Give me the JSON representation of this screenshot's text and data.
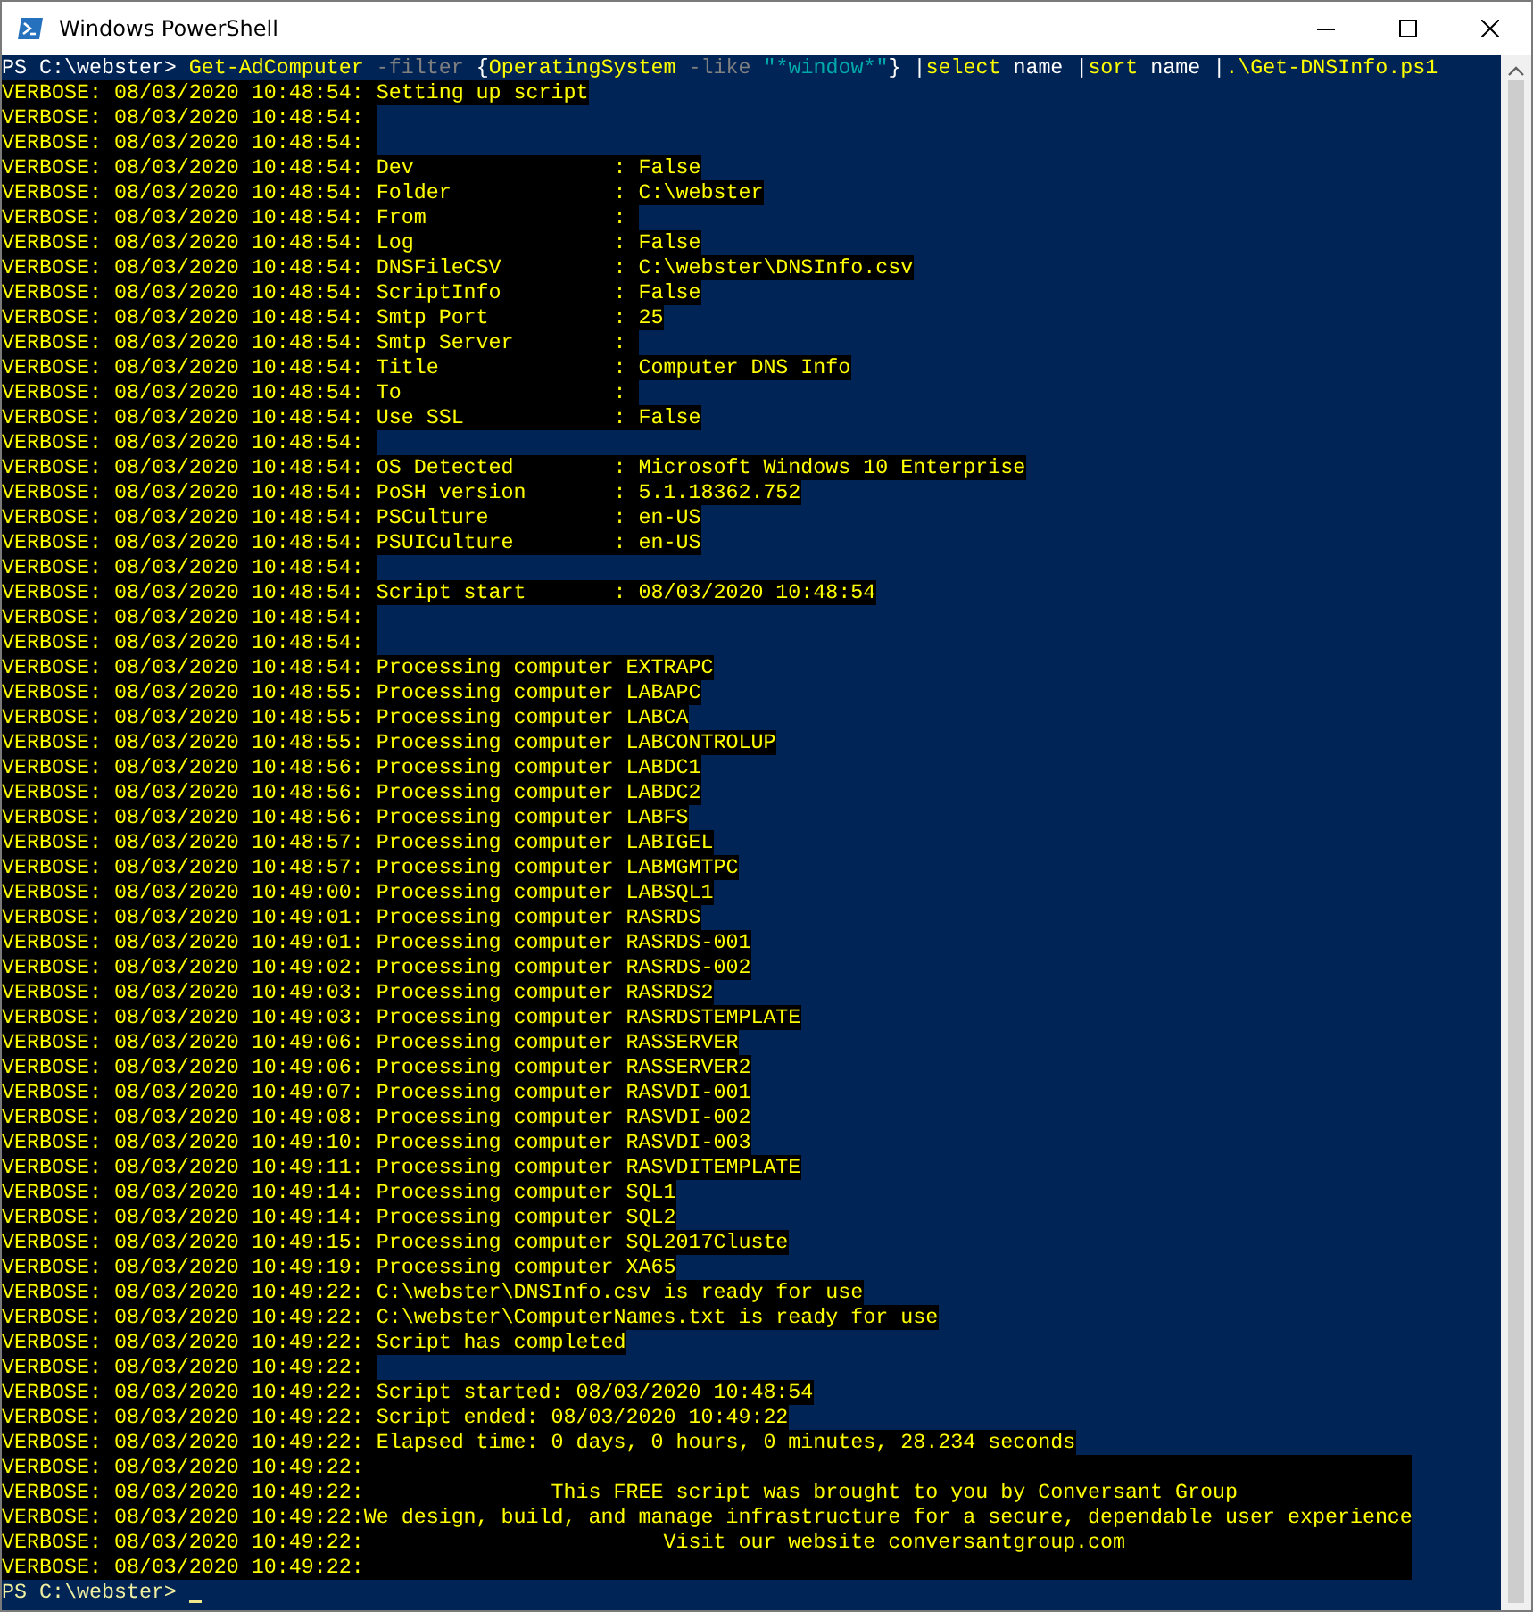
{
  "window": {
    "title": "Windows PowerShell"
  },
  "command": {
    "prompt": "PS C:\\webster>",
    "tokens": [
      {
        "text": "Get-AdComputer",
        "kind": "command"
      },
      {
        "text": "-filter",
        "kind": "parameter"
      },
      {
        "text": "{",
        "kind": "plain"
      },
      {
        "text": "OperatingSystem",
        "kind": "command",
        "join": true
      },
      {
        "text": "-like",
        "kind": "parameter"
      },
      {
        "text": "\"*window*\"",
        "kind": "string"
      },
      {
        "text": "}",
        "kind": "plain",
        "join": true
      },
      {
        "text": "|",
        "kind": "plain"
      },
      {
        "text": "select",
        "kind": "command",
        "join": true
      },
      {
        "text": "name",
        "kind": "plain"
      },
      {
        "text": "|",
        "kind": "plain"
      },
      {
        "text": "sort",
        "kind": "command",
        "join": true
      },
      {
        "text": "name",
        "kind": "plain"
      },
      {
        "text": "|",
        "kind": "plain"
      },
      {
        "text": ".\\Get-DNSInfo.ps1",
        "kind": "command",
        "join": true
      }
    ]
  },
  "lines": [
    {
      "kind": "message",
      "prefix": "VERBOSE: 08/03/2020 10:48:54:",
      "text": "Setting up script"
    },
    {
      "kind": "message",
      "prefix": "VERBOSE: 08/03/2020 10:48:54:"
    },
    {
      "kind": "message",
      "prefix": "VERBOSE: 08/03/2020 10:48:54:"
    },
    {
      "kind": "field",
      "prefix": "VERBOSE: 08/03/2020 10:48:54:",
      "key": "Dev",
      "sep": ":",
      "value": "False"
    },
    {
      "kind": "field",
      "prefix": "VERBOSE: 08/03/2020 10:48:54:",
      "key": "Folder",
      "sep": ":",
      "value": "C:\\webster"
    },
    {
      "kind": "field",
      "prefix": "VERBOSE: 08/03/2020 10:48:54:",
      "key": "From",
      "sep": ":"
    },
    {
      "kind": "field",
      "prefix": "VERBOSE: 08/03/2020 10:48:54:",
      "key": "Log",
      "sep": ":",
      "value": "False"
    },
    {
      "kind": "field",
      "prefix": "VERBOSE: 08/03/2020 10:48:54:",
      "key": "DNSFileCSV",
      "sep": ":",
      "value": "C:\\webster\\DNSInfo.csv"
    },
    {
      "kind": "field",
      "prefix": "VERBOSE: 08/03/2020 10:48:54:",
      "key": "ScriptInfo",
      "sep": ":",
      "value": "False"
    },
    {
      "kind": "field",
      "prefix": "VERBOSE: 08/03/2020 10:48:54:",
      "key": "Smtp Port",
      "sep": ":",
      "value": "25"
    },
    {
      "kind": "field",
      "prefix": "VERBOSE: 08/03/2020 10:48:54:",
      "key": "Smtp Server",
      "sep": ":"
    },
    {
      "kind": "field",
      "prefix": "VERBOSE: 08/03/2020 10:48:54:",
      "key": "Title",
      "sep": ":",
      "value": "Computer DNS Info"
    },
    {
      "kind": "field",
      "prefix": "VERBOSE: 08/03/2020 10:48:54:",
      "key": "To",
      "sep": ":"
    },
    {
      "kind": "field",
      "prefix": "VERBOSE: 08/03/2020 10:48:54:",
      "key": "Use SSL",
      "sep": ":",
      "value": "False"
    },
    {
      "kind": "message",
      "prefix": "VERBOSE: 08/03/2020 10:48:54:"
    },
    {
      "kind": "field",
      "prefix": "VERBOSE: 08/03/2020 10:48:54:",
      "key": "OS Detected",
      "sep": ":",
      "value": "Microsoft Windows 10 Enterprise"
    },
    {
      "kind": "field",
      "prefix": "VERBOSE: 08/03/2020 10:48:54:",
      "key": "PoSH version",
      "sep": ":",
      "value": "5.1.18362.752"
    },
    {
      "kind": "field",
      "prefix": "VERBOSE: 08/03/2020 10:48:54:",
      "key": "PSCulture",
      "sep": ":",
      "value": "en-US"
    },
    {
      "kind": "field",
      "prefix": "VERBOSE: 08/03/2020 10:48:54:",
      "key": "PSUICulture",
      "sep": ":",
      "value": "en-US"
    },
    {
      "kind": "message",
      "prefix": "VERBOSE: 08/03/2020 10:48:54:"
    },
    {
      "kind": "field",
      "prefix": "VERBOSE: 08/03/2020 10:48:54:",
      "key": "Script start",
      "sep": ":",
      "value": "08/03/2020 10:48:54"
    },
    {
      "kind": "message",
      "prefix": "VERBOSE: 08/03/2020 10:48:54:"
    },
    {
      "kind": "message",
      "prefix": "VERBOSE: 08/03/2020 10:48:54:"
    },
    {
      "kind": "message",
      "prefix": "VERBOSE: 08/03/2020 10:48:54:",
      "text": "Processing computer EXTRAPC"
    },
    {
      "kind": "message",
      "prefix": "VERBOSE: 08/03/2020 10:48:55:",
      "text": "Processing computer LABAPC"
    },
    {
      "kind": "message",
      "prefix": "VERBOSE: 08/03/2020 10:48:55:",
      "text": "Processing computer LABCA"
    },
    {
      "kind": "message",
      "prefix": "VERBOSE: 08/03/2020 10:48:55:",
      "text": "Processing computer LABCONTROLUP"
    },
    {
      "kind": "message",
      "prefix": "VERBOSE: 08/03/2020 10:48:56:",
      "text": "Processing computer LABDC1"
    },
    {
      "kind": "message",
      "prefix": "VERBOSE: 08/03/2020 10:48:56:",
      "text": "Processing computer LABDC2"
    },
    {
      "kind": "message",
      "prefix": "VERBOSE: 08/03/2020 10:48:56:",
      "text": "Processing computer LABFS"
    },
    {
      "kind": "message",
      "prefix": "VERBOSE: 08/03/2020 10:48:57:",
      "text": "Processing computer LABIGEL"
    },
    {
      "kind": "message",
      "prefix": "VERBOSE: 08/03/2020 10:48:57:",
      "text": "Processing computer LABMGMTPC"
    },
    {
      "kind": "message",
      "prefix": "VERBOSE: 08/03/2020 10:49:00:",
      "text": "Processing computer LABSQL1"
    },
    {
      "kind": "message",
      "prefix": "VERBOSE: 08/03/2020 10:49:01:",
      "text": "Processing computer RASRDS"
    },
    {
      "kind": "message",
      "prefix": "VERBOSE: 08/03/2020 10:49:01:",
      "text": "Processing computer RASRDS-001"
    },
    {
      "kind": "message",
      "prefix": "VERBOSE: 08/03/2020 10:49:02:",
      "text": "Processing computer RASRDS-002"
    },
    {
      "kind": "message",
      "prefix": "VERBOSE: 08/03/2020 10:49:03:",
      "text": "Processing computer RASRDS2"
    },
    {
      "kind": "message",
      "prefix": "VERBOSE: 08/03/2020 10:49:03:",
      "text": "Processing computer RASRDSTEMPLATE"
    },
    {
      "kind": "message",
      "prefix": "VERBOSE: 08/03/2020 10:49:06:",
      "text": "Processing computer RASSERVER"
    },
    {
      "kind": "message",
      "prefix": "VERBOSE: 08/03/2020 10:49:06:",
      "text": "Processing computer RASSERVER2"
    },
    {
      "kind": "message",
      "prefix": "VERBOSE: 08/03/2020 10:49:07:",
      "text": "Processing computer RASVDI-001"
    },
    {
      "kind": "message",
      "prefix": "VERBOSE: 08/03/2020 10:49:08:",
      "text": "Processing computer RASVDI-002"
    },
    {
      "kind": "message",
      "prefix": "VERBOSE: 08/03/2020 10:49:10:",
      "text": "Processing computer RASVDI-003"
    },
    {
      "kind": "message",
      "prefix": "VERBOSE: 08/03/2020 10:49:11:",
      "text": "Processing computer RASVDITEMPLATE"
    },
    {
      "kind": "message",
      "prefix": "VERBOSE: 08/03/2020 10:49:14:",
      "text": "Processing computer SQL1"
    },
    {
      "kind": "message",
      "prefix": "VERBOSE: 08/03/2020 10:49:14:",
      "text": "Processing computer SQL2"
    },
    {
      "kind": "message",
      "prefix": "VERBOSE: 08/03/2020 10:49:15:",
      "text": "Processing computer SQL2017Cluste"
    },
    {
      "kind": "message",
      "prefix": "VERBOSE: 08/03/2020 10:49:19:",
      "text": "Processing computer XA65"
    },
    {
      "kind": "message",
      "prefix": "VERBOSE: 08/03/2020 10:49:22:",
      "text": "C:\\webster\\DNSInfo.csv is ready for use"
    },
    {
      "kind": "message",
      "prefix": "VERBOSE: 08/03/2020 10:49:22:",
      "text": "C:\\webster\\ComputerNames.txt is ready for use"
    },
    {
      "kind": "message",
      "prefix": "VERBOSE: 08/03/2020 10:49:22:",
      "text": "Script has completed"
    },
    {
      "kind": "message",
      "prefix": "VERBOSE: 08/03/2020 10:49:22:"
    },
    {
      "kind": "message",
      "prefix": "VERBOSE: 08/03/2020 10:49:22:",
      "text": "Script started: 08/03/2020 10:48:54"
    },
    {
      "kind": "message",
      "prefix": "VERBOSE: 08/03/2020 10:49:22:",
      "text": "Script ended: 08/03/2020 10:49:22"
    },
    {
      "kind": "message",
      "prefix": "VERBOSE: 08/03/2020 10:49:22:",
      "text": "Elapsed time: 0 days, 0 hours, 0 minutes, 28.234 seconds"
    },
    {
      "kind": "banner",
      "prefix": "VERBOSE: 08/03/2020 10:49:22:"
    },
    {
      "kind": "banner",
      "prefix": "VERBOSE: 08/03/2020 10:49:22:",
      "text": "This FREE script was brought to you by Conversant Group"
    },
    {
      "kind": "banner",
      "prefix": "VERBOSE: 08/03/2020 10:49:22:",
      "text": "We design, build, and manage infrastructure for a secure, dependable user experience"
    },
    {
      "kind": "banner",
      "prefix": "VERBOSE: 08/03/2020 10:49:22:",
      "text": "Visit our website conversantgroup.com"
    },
    {
      "kind": "banner",
      "prefix": "VERBOSE: 08/03/2020 10:49:22:"
    }
  ],
  "final_prompt": "PS C:\\webster>"
}
